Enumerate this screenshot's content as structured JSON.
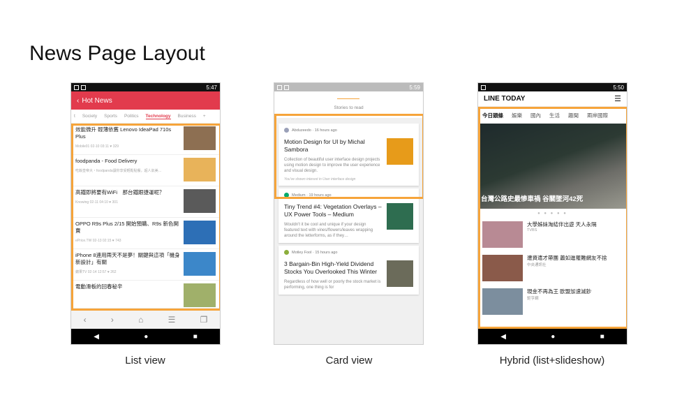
{
  "slide": {
    "title": "News Page Layout",
    "captions": [
      "List view",
      "Card view",
      "Hybrid (list+slideshow)"
    ]
  },
  "list_view": {
    "status_time": "5:47",
    "header_title": "Hot News",
    "tabs": [
      "t",
      "Society",
      "Sports",
      "Politics",
      "Technology",
      "Business",
      "+"
    ],
    "active_tab": "Technology",
    "items": [
      {
        "title": "效能微升 輕薄依舊 Lenovo IdeaPad 710s Plus",
        "meta": "Mobile01   02-10 03:11   ♥ 329",
        "thumb_color": "#8d6f52"
      },
      {
        "title": "foodpanda - Food Delivery",
        "meta": "吃飯皇帝大・foodpanda讓你享受輕鬆點餐，超人氣美…",
        "thumb_color": "#e8b35a"
      },
      {
        "title": "高鐵即將要有WiFi　那台鐵跟捷運呢？",
        "meta": "Knowing   02-11 04:10   ♥ 301",
        "thumb_color": "#5a5a5a"
      },
      {
        "title": "OPPO R9s Plus 2/15 開始預購、R9s 新色開賣",
        "meta": "ePrice.TW   02-13 02:15   ♥ 743",
        "thumb_color": "#2d6fb6"
      },
      {
        "title": "iPhone 8連用兩天不是夢！關鍵與這項「機身新設計」有關",
        "meta": "蘋果TV   02-14 12:57   ♥ 262",
        "thumb_color": "#3c87c9"
      },
      {
        "title": "電動滑板的回春秘辛",
        "meta": "",
        "thumb_color": "#a0b06a"
      }
    ]
  },
  "card_view": {
    "status_time": "5:59",
    "stories_label": "Stories to read",
    "cards": [
      {
        "source": "Abduzeedo · 16 hours ago",
        "title": "Motion Design for UI by Michal Sambora",
        "desc": "Collection of beautiful user interface design projects using motion design to improve the user experience and visual design.",
        "note": "You've shown interest in User interface design",
        "thumb_color": "#e79b1a",
        "dot_color": "#9aa0b8"
      },
      {
        "source": "Medium · 19 hours ago",
        "title": "Tiny Trend #4: Vegetation Overlays – UX Power Tools – Medium",
        "desc": "Wouldn't it be cool and unique if your design featured text with vines/flowers/leaves wrapping around the letterforms, as if they…",
        "note": "",
        "thumb_color": "#2e6d50",
        "dot_color": "#00ab6c"
      },
      {
        "source": "Motley Fool · 15 hours ago",
        "title": "3 Bargain-Bin High-Yield Dividend Stocks You Overlooked This Winter",
        "desc": "Regardless of how well or poorly the stock market is performing, one thing is for",
        "note": "",
        "thumb_color": "#6b6b5a",
        "dot_color": "#8cae3c"
      }
    ]
  },
  "hybrid_view": {
    "status_time": "5:50",
    "logo": "LINE TODAY",
    "tabs": [
      "今日頭條",
      "娛樂",
      "國內",
      "生活",
      "趣聞",
      "兩岸國際"
    ],
    "hero_caption": "台灣公路史最慘車禍 谷關墜河42死",
    "slide_dots": "● ● ● ● ●",
    "items": [
      {
        "title": "大學姊妹淘結伴出遊 天人永隔",
        "source": "TVBS",
        "thumb_color": "#b88a94"
      },
      {
        "title": "遭資遣才帶團 蕭如進罹難網友不捨",
        "source": "中央通訊社",
        "thumb_color": "#8a5a4a"
      },
      {
        "title": "現金不再為王 歐盟加速減鈔",
        "source": "鉅亨網",
        "thumb_color": "#7c8e9e"
      }
    ]
  }
}
